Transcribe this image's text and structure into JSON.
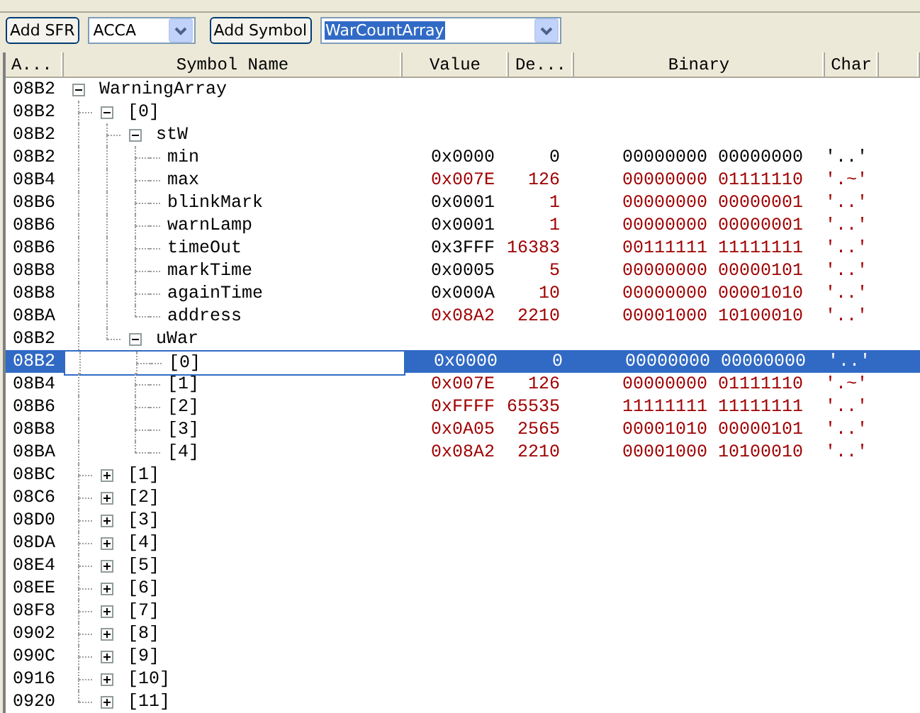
{
  "toolbar": {
    "sfr_button": "Add SFR",
    "sfr_combo": "ACCA",
    "symbol_button": "Add Symbol",
    "symbol_combo": "WarCountArray"
  },
  "table": {
    "columns": [
      "A...",
      "Symbol Name",
      "Value",
      "De...",
      "Binary",
      "Char"
    ],
    "rows": [
      {
        "address": "08B2",
        "name": "WarningArray",
        "expanded": true,
        "selected": false,
        "children": [
          {
            "address": "08B2",
            "name": "[0]",
            "expanded": true,
            "selected": false,
            "children": [
              {
                "address": "08B2",
                "name": "stW",
                "expanded": true,
                "selected": false,
                "children": [
                  {
                    "address": "08B2",
                    "name": "min",
                    "selected": false,
                    "value": "0x0000",
                    "decimal": "0",
                    "binary": "00000000 00000000",
                    "char": "'..'",
                    "value_changed": false,
                    "changed": false
                  },
                  {
                    "address": "08B4",
                    "name": "max",
                    "selected": false,
                    "value": "0x007E",
                    "decimal": "126",
                    "binary": "00000000 01111110",
                    "char": "'.~'",
                    "value_changed": true,
                    "changed": true
                  },
                  {
                    "address": "08B6",
                    "name": "blinkMark",
                    "selected": false,
                    "value": "0x0001",
                    "decimal": "1",
                    "binary": "00000000 00000001",
                    "char": "'..'",
                    "value_changed": false,
                    "changed": true
                  },
                  {
                    "address": "08B6",
                    "name": "warnLamp",
                    "selected": false,
                    "value": "0x0001",
                    "decimal": "1",
                    "binary": "00000000 00000001",
                    "char": "'..'",
                    "value_changed": false,
                    "changed": true
                  },
                  {
                    "address": "08B6",
                    "name": "timeOut",
                    "selected": false,
                    "value": "0x3FFF",
                    "decimal": "16383",
                    "binary": "00111111 11111111",
                    "char": "'..'",
                    "value_changed": false,
                    "changed": true
                  },
                  {
                    "address": "08B8",
                    "name": "markTime",
                    "selected": false,
                    "value": "0x0005",
                    "decimal": "5",
                    "binary": "00000000 00000101",
                    "char": "'..'",
                    "value_changed": false,
                    "changed": true
                  },
                  {
                    "address": "08B8",
                    "name": "againTime",
                    "selected": false,
                    "value": "0x000A",
                    "decimal": "10",
                    "binary": "00000000 00001010",
                    "char": "'..'",
                    "value_changed": false,
                    "changed": true
                  },
                  {
                    "address": "08BA",
                    "name": "address",
                    "selected": false,
                    "value": "0x08A2",
                    "decimal": "2210",
                    "binary": "00001000 10100010",
                    "char": "'..'",
                    "value_changed": true,
                    "changed": true
                  }
                ]
              },
              {
                "address": "08B2",
                "name": "uWar",
                "expanded": true,
                "selected": false,
                "children": [
                  {
                    "address": "08B2",
                    "name": "[0]",
                    "selected": true,
                    "value": "0x0000",
                    "decimal": "0",
                    "binary": "00000000 00000000",
                    "char": "'..'",
                    "value_changed": false,
                    "changed": false
                  },
                  {
                    "address": "08B4",
                    "name": "[1]",
                    "selected": false,
                    "value": "0x007E",
                    "decimal": "126",
                    "binary": "00000000 01111110",
                    "char": "'.~'",
                    "value_changed": true,
                    "changed": true
                  },
                  {
                    "address": "08B6",
                    "name": "[2]",
                    "selected": false,
                    "value": "0xFFFF",
                    "decimal": "65535",
                    "binary": "11111111 11111111",
                    "char": "'..'",
                    "value_changed": true,
                    "changed": true
                  },
                  {
                    "address": "08B8",
                    "name": "[3]",
                    "selected": false,
                    "value": "0x0A05",
                    "decimal": "2565",
                    "binary": "00001010 00000101",
                    "char": "'..'",
                    "value_changed": true,
                    "changed": true
                  },
                  {
                    "address": "08BA",
                    "name": "[4]",
                    "selected": false,
                    "value": "0x08A2",
                    "decimal": "2210",
                    "binary": "00001000 10100010",
                    "char": "'..'",
                    "value_changed": true,
                    "changed": true
                  }
                ]
              }
            ]
          },
          {
            "address": "08BC",
            "name": "[1]",
            "expanded": false,
            "selected": false
          },
          {
            "address": "08C6",
            "name": "[2]",
            "expanded": false,
            "selected": false
          },
          {
            "address": "08D0",
            "name": "[3]",
            "expanded": false,
            "selected": false
          },
          {
            "address": "08DA",
            "name": "[4]",
            "expanded": false,
            "selected": false
          },
          {
            "address": "08E4",
            "name": "[5]",
            "expanded": false,
            "selected": false
          },
          {
            "address": "08EE",
            "name": "[6]",
            "expanded": false,
            "selected": false
          },
          {
            "address": "08F8",
            "name": "[7]",
            "expanded": false,
            "selected": false
          },
          {
            "address": "0902",
            "name": "[8]",
            "expanded": false,
            "selected": false
          },
          {
            "address": "090C",
            "name": "[9]",
            "expanded": false,
            "selected": false
          },
          {
            "address": "0916",
            "name": "[10]",
            "expanded": false,
            "selected": false
          },
          {
            "address": "0920",
            "name": "[11]",
            "expanded": false,
            "selected": false
          }
        ]
      }
    ]
  }
}
